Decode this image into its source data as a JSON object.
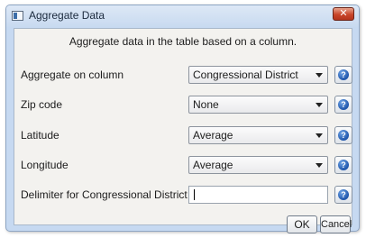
{
  "window": {
    "title": "Aggregate Data",
    "close_glyph": "✕"
  },
  "header": {
    "text": "Aggregate data in the table based on a column."
  },
  "fields": [
    {
      "label": "Aggregate on column",
      "value": "Congressional District"
    },
    {
      "label": "Zip code",
      "value": "None"
    },
    {
      "label": "Latitude",
      "value": "Average"
    },
    {
      "label": "Longitude",
      "value": "Average"
    },
    {
      "label": "Delimiter for Congressional District",
      "value": ""
    }
  ],
  "help": {
    "glyph": "?"
  },
  "buttons": {
    "ok": "OK",
    "cancel": "Cancel"
  },
  "colors": {
    "accent": "#1f56ab",
    "close": "#c8452a",
    "frame": "#c6d9f1"
  }
}
